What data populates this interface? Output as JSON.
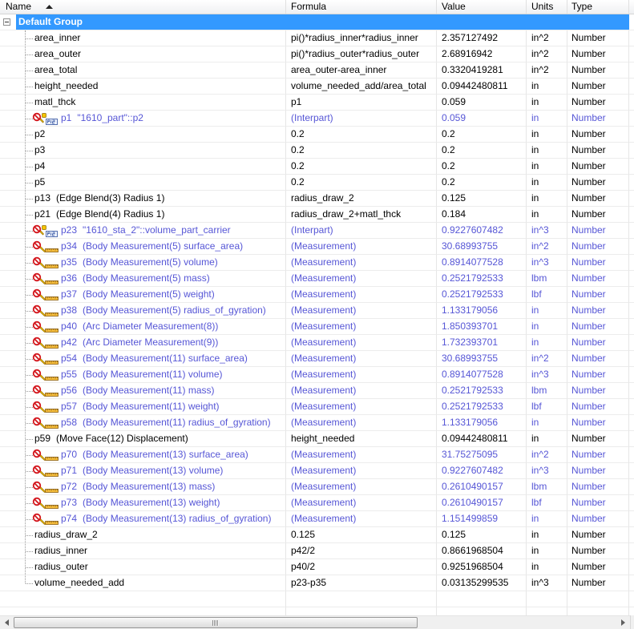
{
  "header": {
    "columns": [
      "Name",
      "Formula",
      "Value",
      "Units",
      "Type"
    ],
    "sort_indicator": "sort-ascending-icon"
  },
  "group": {
    "label": "Default Group",
    "expanded": true
  },
  "colors": {
    "selection": "#3399ff",
    "linked_text": "#5656d6",
    "normal_text": "#000000"
  },
  "rows": [
    {
      "name": "area_inner",
      "formula": "pi()*radius_inner*radius_inner",
      "value": "2.357127492",
      "units": "in^2",
      "type": "Number"
    },
    {
      "name": "area_outer",
      "formula": "pi()*radius_outer*radius_outer",
      "value": "2.68916942",
      "units": "in^2",
      "type": "Number"
    },
    {
      "name": "area_total",
      "formula": "area_outer-area_inner",
      "value": "0.3320419281",
      "units": "in^2",
      "type": "Number"
    },
    {
      "name": "height_needed",
      "formula": "volume_needed_add/area_total",
      "value": "0.09442480811",
      "units": "in",
      "type": "Number"
    },
    {
      "name": "matl_thck",
      "formula": "p1",
      "value": "0.059",
      "units": "in",
      "type": "Number"
    },
    {
      "name": "p1",
      "note": "\"1610_part\"::p2",
      "formula": "(Interpart)",
      "value": "0.059",
      "units": "in",
      "type": "Number",
      "icon": "interpart-icon"
    },
    {
      "name": "p2",
      "formula": "0.2",
      "value": "0.2",
      "units": "in",
      "type": "Number"
    },
    {
      "name": "p3",
      "formula": "0.2",
      "value": "0.2",
      "units": "in",
      "type": "Number"
    },
    {
      "name": "p4",
      "formula": "0.2",
      "value": "0.2",
      "units": "in",
      "type": "Number"
    },
    {
      "name": "p5",
      "formula": "0.2",
      "value": "0.2",
      "units": "in",
      "type": "Number"
    },
    {
      "name": "p13",
      "note": "(Edge Blend(3) Radius 1)",
      "formula": "radius_draw_2",
      "value": "0.125",
      "units": "in",
      "type": "Number"
    },
    {
      "name": "p21",
      "note": "(Edge Blend(4) Radius 1)",
      "formula": "radius_draw_2+matl_thck",
      "value": "0.184",
      "units": "in",
      "type": "Number"
    },
    {
      "name": "p23",
      "note": "\"1610_sta_2\"::volume_part_carrier",
      "formula": "(Interpart)",
      "value": "0.9227607482",
      "units": "in^3",
      "type": "Number",
      "icon": "interpart-icon"
    },
    {
      "name": "p34",
      "note": "(Body Measurement(5) surface_area)",
      "formula": "(Measurement)",
      "value": "30.68993755",
      "units": "in^2",
      "type": "Number",
      "icon": "measurement-icon"
    },
    {
      "name": "p35",
      "note": "(Body Measurement(5) volume)",
      "formula": "(Measurement)",
      "value": "0.8914077528",
      "units": "in^3",
      "type": "Number",
      "icon": "measurement-icon"
    },
    {
      "name": "p36",
      "note": "(Body Measurement(5) mass)",
      "formula": "(Measurement)",
      "value": "0.2521792533",
      "units": "lbm",
      "type": "Number",
      "icon": "measurement-icon"
    },
    {
      "name": "p37",
      "note": "(Body Measurement(5) weight)",
      "formula": "(Measurement)",
      "value": "0.2521792533",
      "units": "lbf",
      "type": "Number",
      "icon": "measurement-icon"
    },
    {
      "name": "p38",
      "note": "(Body Measurement(5) radius_of_gyration)",
      "formula": "(Measurement)",
      "value": "1.133179056",
      "units": "in",
      "type": "Number",
      "icon": "measurement-icon"
    },
    {
      "name": "p40",
      "note": "(Arc Diameter Measurement(8))",
      "formula": "(Measurement)",
      "value": "1.850393701",
      "units": "in",
      "type": "Number",
      "icon": "measurement-icon"
    },
    {
      "name": "p42",
      "note": "(Arc Diameter Measurement(9))",
      "formula": "(Measurement)",
      "value": "1.732393701",
      "units": "in",
      "type": "Number",
      "icon": "measurement-icon"
    },
    {
      "name": "p54",
      "note": "(Body Measurement(11) surface_area)",
      "formula": "(Measurement)",
      "value": "30.68993755",
      "units": "in^2",
      "type": "Number",
      "icon": "measurement-icon"
    },
    {
      "name": "p55",
      "note": "(Body Measurement(11) volume)",
      "formula": "(Measurement)",
      "value": "0.8914077528",
      "units": "in^3",
      "type": "Number",
      "icon": "measurement-icon"
    },
    {
      "name": "p56",
      "note": "(Body Measurement(11) mass)",
      "formula": "(Measurement)",
      "value": "0.2521792533",
      "units": "lbm",
      "type": "Number",
      "icon": "measurement-icon"
    },
    {
      "name": "p57",
      "note": "(Body Measurement(11) weight)",
      "formula": "(Measurement)",
      "value": "0.2521792533",
      "units": "lbf",
      "type": "Number",
      "icon": "measurement-icon"
    },
    {
      "name": "p58",
      "note": "(Body Measurement(11) radius_of_gyration)",
      "formula": "(Measurement)",
      "value": "1.133179056",
      "units": "in",
      "type": "Number",
      "icon": "measurement-icon"
    },
    {
      "name": "p59",
      "note": "(Move Face(12) Displacement)",
      "formula": "height_needed",
      "value": "0.09442480811",
      "units": "in",
      "type": "Number"
    },
    {
      "name": "p70",
      "note": "(Body Measurement(13) surface_area)",
      "formula": "(Measurement)",
      "value": "31.75275095",
      "units": "in^2",
      "type": "Number",
      "icon": "measurement-icon"
    },
    {
      "name": "p71",
      "note": "(Body Measurement(13) volume)",
      "formula": "(Measurement)",
      "value": "0.9227607482",
      "units": "in^3",
      "type": "Number",
      "icon": "measurement-icon"
    },
    {
      "name": "p72",
      "note": "(Body Measurement(13) mass)",
      "formula": "(Measurement)",
      "value": "0.2610490157",
      "units": "lbm",
      "type": "Number",
      "icon": "measurement-icon"
    },
    {
      "name": "p73",
      "note": "(Body Measurement(13) weight)",
      "formula": "(Measurement)",
      "value": "0.2610490157",
      "units": "lbf",
      "type": "Number",
      "icon": "measurement-icon"
    },
    {
      "name": "p74",
      "note": "(Body Measurement(13) radius_of_gyration)",
      "formula": "(Measurement)",
      "value": "1.151499859",
      "units": "in",
      "type": "Number",
      "icon": "measurement-icon"
    },
    {
      "name": "radius_draw_2",
      "formula": "0.125",
      "value": "0.125",
      "units": "in",
      "type": "Number"
    },
    {
      "name": "radius_inner",
      "formula": "p42/2",
      "value": "0.8661968504",
      "units": "in",
      "type": "Number"
    },
    {
      "name": "radius_outer",
      "formula": "p40/2",
      "value": "0.9251968504",
      "units": "in",
      "type": "Number"
    },
    {
      "name": "volume_needed_add",
      "formula": "p23-p35",
      "value": "0.03135299535",
      "units": "in^3",
      "type": "Number"
    }
  ],
  "scrollbar": {
    "position_percent": 0,
    "visible_percent": 67
  }
}
